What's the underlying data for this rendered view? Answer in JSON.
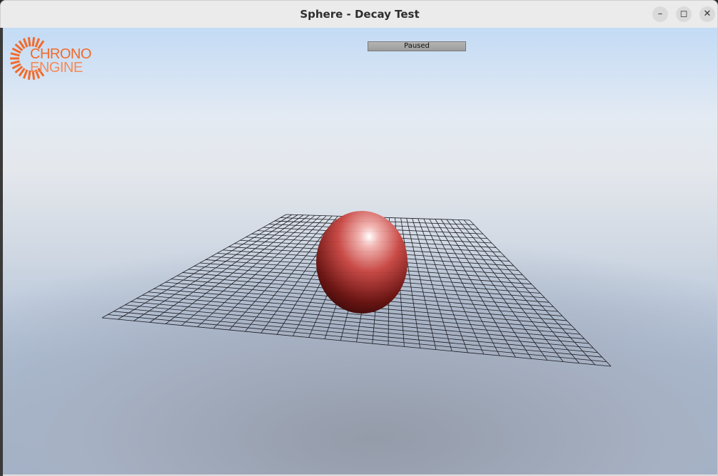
{
  "window": {
    "title": "Sphere - Decay Test",
    "controls": [
      "minimize",
      "maximize",
      "close"
    ]
  },
  "logo": {
    "line1": "CHRONO",
    "line2": "ENGINE",
    "color": "#f26a2a"
  },
  "status_label": "Paused",
  "scene": {
    "objects": [
      "wireframe-ground-grid",
      "red-sphere"
    ],
    "sphere_color": "#d9534f"
  },
  "icons": {
    "minimize": "minimize-icon",
    "maximize": "maximize-icon",
    "close": "close-icon"
  }
}
